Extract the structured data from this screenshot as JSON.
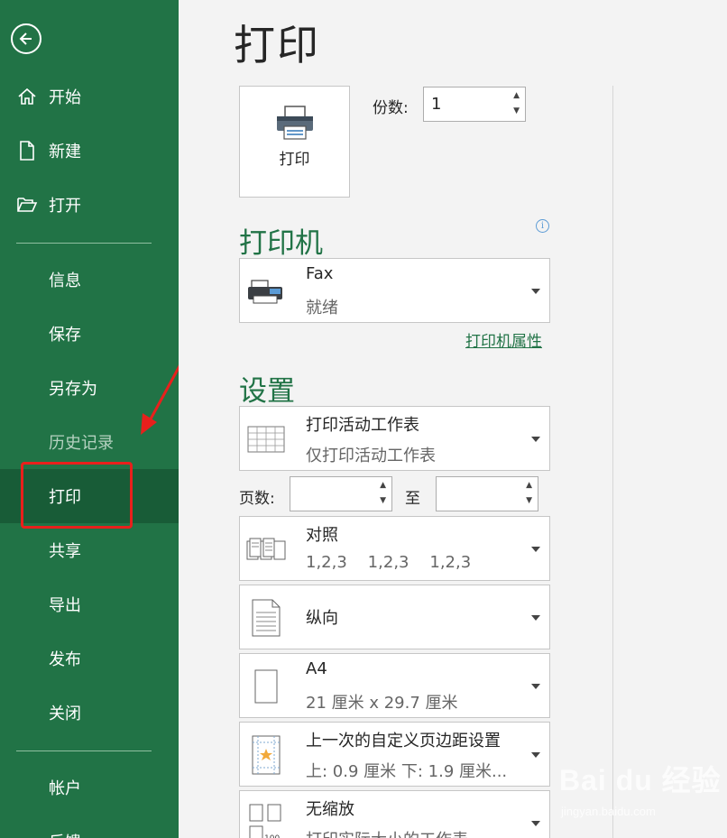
{
  "sidebar": {
    "items": [
      {
        "label": "开始",
        "icon": "home-icon"
      },
      {
        "label": "新建",
        "icon": "new-doc-icon"
      },
      {
        "label": "打开",
        "icon": "folder-open-icon"
      },
      {
        "label": "信息"
      },
      {
        "label": "保存"
      },
      {
        "label": "另存为"
      },
      {
        "label": "历史记录"
      },
      {
        "label": "打印"
      },
      {
        "label": "共享"
      },
      {
        "label": "导出"
      },
      {
        "label": "发布"
      },
      {
        "label": "关闭"
      },
      {
        "label": "帐户"
      },
      {
        "label": "反馈"
      }
    ]
  },
  "main": {
    "title": "打印",
    "print_button": "打印",
    "copies_label": "份数:",
    "copies_value": "1",
    "printer_heading": "打印机",
    "printer_name": "Fax",
    "printer_status": "就绪",
    "printer_properties": "打印机属性",
    "settings_heading": "设置",
    "settings": {
      "what": {
        "title": "打印活动工作表",
        "desc": "仅打印活动工作表"
      },
      "pages_label": "页数:",
      "pages_from": "",
      "to_label": "至",
      "pages_to": "",
      "collate": {
        "title": "对照",
        "desc": "1,2,3    1,2,3    1,2,3"
      },
      "orientation": {
        "title": "纵向"
      },
      "paper": {
        "title": "A4",
        "desc": "21 厘米 x 29.7 厘米"
      },
      "margins": {
        "title": "上一次的自定义页边距设置",
        "desc": "上: 0.9 厘米 下: 1.9 厘米..."
      },
      "scaling": {
        "title": "无缩放",
        "desc": "打印实际大小的工作表"
      }
    }
  },
  "watermark": {
    "text": "Bai du 经验",
    "sub": "jingyan.baidu.com"
  },
  "colors": {
    "brand": "#217346",
    "active": "#185c37",
    "annotation": "#e8201c"
  }
}
